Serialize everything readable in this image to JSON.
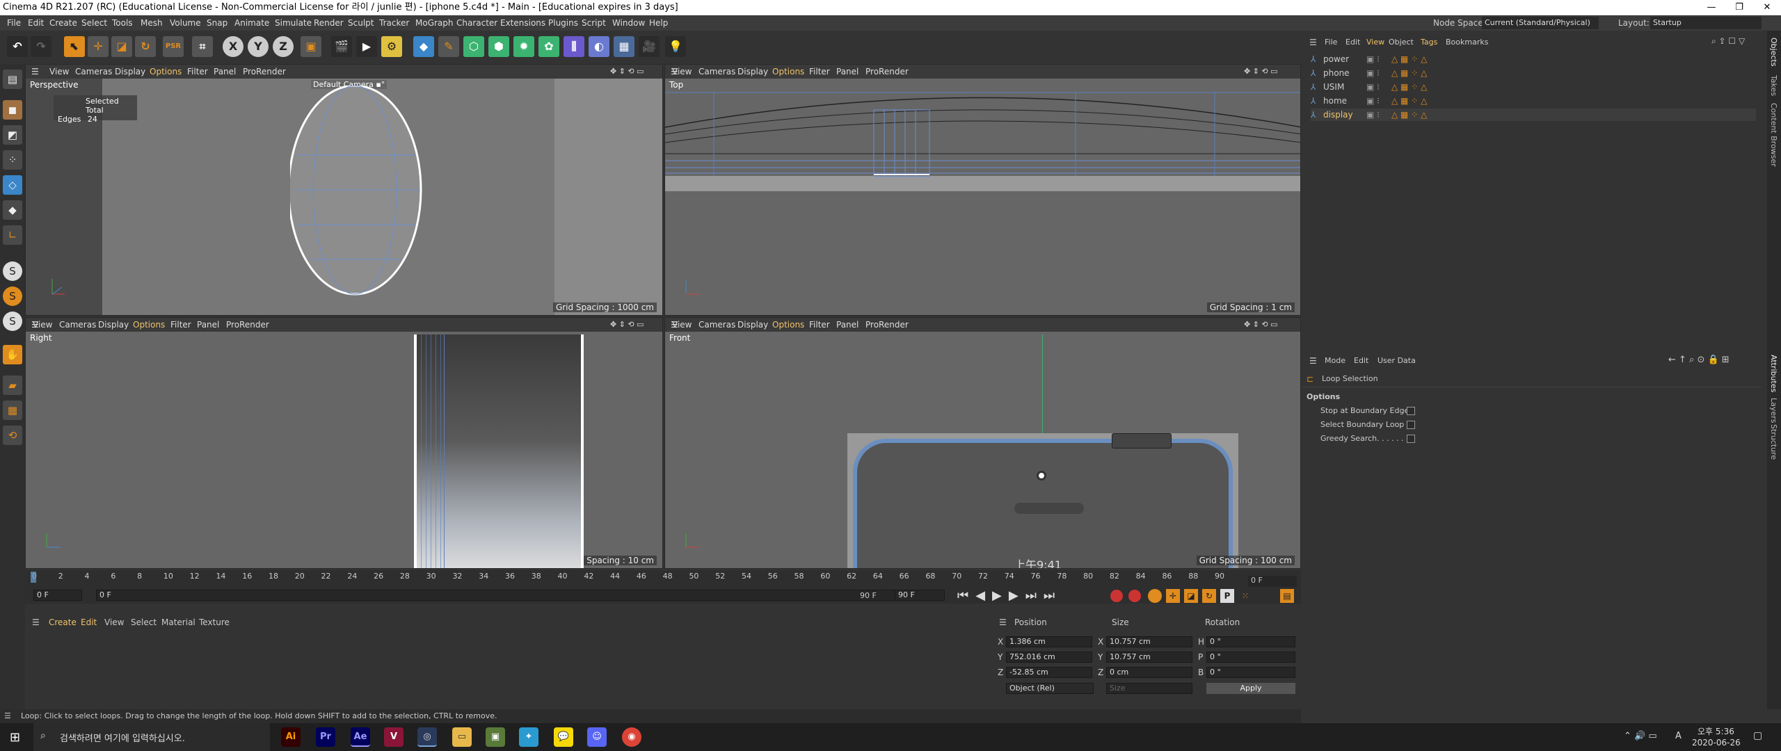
{
  "window": {
    "title": "Cinema 4D R21.207 (RC) (Educational License - Non-Commercial License for 라이 / junlie 편) - [iphone 5.c4d *] - Main - [Educational expires in 3 days]"
  },
  "menu": [
    "File",
    "Edit",
    "Create",
    "Select",
    "Tools",
    "Mesh",
    "Volume",
    "Snap",
    "Animate",
    "Simulate",
    "Render",
    "Sculpt",
    "Tracker",
    "MoGraph",
    "Character",
    "Extensions",
    "Plugins",
    "Script",
    "Window",
    "Help"
  ],
  "nodespace": {
    "label": "Node Space:",
    "value": "Current (Standard/Physical)"
  },
  "layout": {
    "label": "Layout:",
    "value": "Startup"
  },
  "viewport_menu": [
    "View",
    "Cameras",
    "Display",
    "Options",
    "Filter",
    "Panel",
    "ProRender"
  ],
  "viewports": {
    "perspective": {
      "name": "Perspective",
      "camera": "Default Camera ▪°",
      "grid": "Grid Spacing : 1000 cm",
      "stats_header": "Selected Total",
      "stats_label": "Edges",
      "stats_value": "24"
    },
    "top": {
      "name": "Top",
      "grid": "Grid Spacing : 1 cm"
    },
    "right": {
      "name": "Right",
      "grid": "Spacing : 10 cm"
    },
    "front": {
      "name": "Front",
      "grid": "Grid Spacing : 100 cm",
      "status_time": "上午9:41"
    }
  },
  "timeline": {
    "ticks": [
      "0",
      "2",
      "4",
      "6",
      "8",
      "10",
      "12",
      "14",
      "16",
      "18",
      "20",
      "22",
      "24",
      "26",
      "28",
      "30",
      "32",
      "34",
      "36",
      "38",
      "40",
      "42",
      "44",
      "46",
      "48",
      "50",
      "52",
      "54",
      "56",
      "58",
      "60",
      "62",
      "64",
      "66",
      "68",
      "70",
      "72",
      "74",
      "76",
      "78",
      "80",
      "82",
      "84",
      "86",
      "88",
      "90"
    ],
    "current": "0 F",
    "start": "0 F",
    "start2": "0 F",
    "end": "90 F",
    "end2": "90 F"
  },
  "material_menu": [
    "Create",
    "Edit",
    "View",
    "Select",
    "Material",
    "Texture"
  ],
  "coords": {
    "headers": [
      "Position",
      "Size",
      "Rotation"
    ],
    "rows": [
      {
        "axis": "X",
        "pos": "1.386 cm",
        "saxis": "X",
        "size": "10.757 cm",
        "raxis": "H",
        "rot": "0 °"
      },
      {
        "axis": "Y",
        "pos": "752.016 cm",
        "saxis": "Y",
        "size": "10.757 cm",
        "raxis": "P",
        "rot": "0 °"
      },
      {
        "axis": "Z",
        "pos": "-52.85 cm",
        "saxis": "Z",
        "size": "0 cm",
        "raxis": "B",
        "rot": "0 °"
      }
    ],
    "mode": "Object (Rel)",
    "size_mode": "Size",
    "apply": "Apply"
  },
  "objects_menu": [
    "File",
    "Edit",
    "View",
    "Object",
    "Tags",
    "Bookmarks"
  ],
  "objects": [
    "power",
    "phone",
    "USIM",
    "home",
    "display"
  ],
  "attr_menu": [
    "Mode",
    "Edit",
    "User Data"
  ],
  "attributes": {
    "title": "Loop Selection",
    "section": "Options",
    "options": [
      "Stop at Boundary Edges",
      "Select Boundary Loop . .",
      "Greedy Search. . . . . . ."
    ]
  },
  "right_tabs": [
    "Objects",
    "Takes",
    "Content Browser",
    "Attributes",
    "Layers",
    "Structure"
  ],
  "status": "Loop: Click to select loops. Drag to change the length of the loop. Hold down SHIFT to add to the selection, CTRL to remove.",
  "taskbar": {
    "search": "검색하려면 여기에 입력하십시오.",
    "time": "오후 5:36",
    "date": "2020-06-26",
    "ime": "A",
    "apps": [
      "Ai",
      "Pr",
      "Ae"
    ]
  },
  "colors": {
    "accent": "#f0c36a",
    "selection": "#ffffff",
    "grid": "#5b7fbf"
  }
}
